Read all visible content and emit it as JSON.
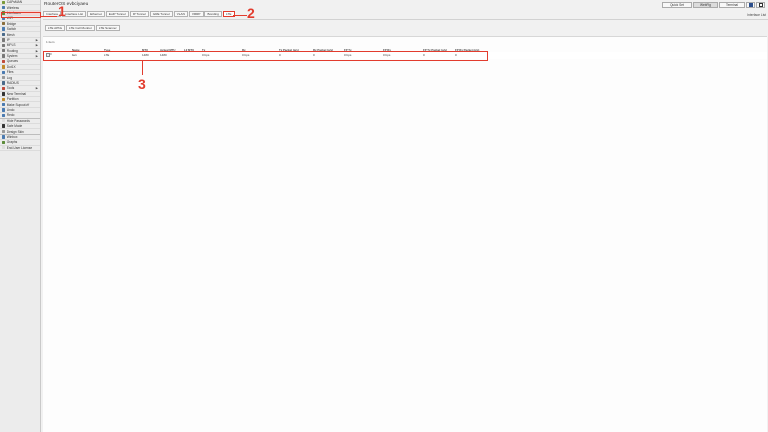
{
  "window": {
    "title": "RouterOS evbciyaeu",
    "view_label": "Interface List"
  },
  "top_buttons": {
    "quick_set": "Quick Set",
    "webfig": "WebFig",
    "terminal": "Terminal"
  },
  "icons": {
    "save": "save-icon",
    "window": "window-icon"
  },
  "sidebar": {
    "items": [
      {
        "label": "CAPsMAN",
        "icon": "capsman-icon",
        "color": "#7a9a3a"
      },
      {
        "label": "Wireless",
        "icon": "wireless-icon",
        "color": "#4a7ab0"
      },
      {
        "label": "Interfaces",
        "icon": "interfaces-icon",
        "color": "#5d8c3a",
        "active": true
      },
      {
        "label": "WiFi",
        "icon": "wifi-icon",
        "color": "#4a7ab0"
      },
      {
        "label": "Bridge",
        "icon": "bridge-icon",
        "color": "#8a6d3b"
      },
      {
        "label": "Switch",
        "icon": "switch-icon",
        "color": "#4a7ab0"
      },
      {
        "label": "Mesh",
        "icon": "mesh-icon",
        "color": "#4a6a8a"
      },
      {
        "label": "IP",
        "icon": "ip-icon",
        "color": "#777777",
        "arrow": true
      },
      {
        "label": "MPLS",
        "icon": "mpls-icon",
        "color": "#777777",
        "arrow": true
      },
      {
        "label": "Routing",
        "icon": "routing-icon",
        "color": "#777777",
        "arrow": true
      },
      {
        "label": "System",
        "icon": "system-icon",
        "color": "#777777",
        "arrow": true
      },
      {
        "label": "Queues",
        "icon": "queues-icon",
        "color": "#c04a3a"
      },
      {
        "label": "Dot1X",
        "icon": "dot1x-icon",
        "color": "#c08a2a"
      },
      {
        "label": "Files",
        "icon": "files-icon",
        "color": "#4a7ab0"
      },
      {
        "label": "Log",
        "icon": "log-icon",
        "color": "#999999"
      },
      {
        "label": "RADIUS",
        "icon": "radius-icon",
        "color": "#4a6a8a"
      },
      {
        "label": "Tools",
        "icon": "tools-icon",
        "color": "#c04a3a",
        "arrow": true
      },
      {
        "label": "New Terminal",
        "icon": "terminal-icon",
        "color": "#333333"
      },
      {
        "label": "Partition",
        "icon": "partition-icon",
        "color": "#c08a2a"
      },
      {
        "label": "Make Supout.rif",
        "icon": "supout-icon",
        "color": "#4a7ab0"
      },
      {
        "label": "Undo",
        "icon": "undo-icon",
        "color": "#4a7ab0"
      },
      {
        "label": "Redo",
        "icon": "redo-icon",
        "color": "#4a7ab0",
        "sep": true
      },
      {
        "label": "Hide Passwords",
        "icon": "hide-passwords-icon",
        "color": "#dddddd"
      },
      {
        "label": "Safe Mode",
        "icon": "safe-mode-icon",
        "color": "#333333"
      },
      {
        "label": "Design Skin",
        "icon": "design-skin-icon",
        "color": "#999999",
        "sep": true
      },
      {
        "label": "Winbox",
        "icon": "winbox-icon",
        "color": "#4a7ab0"
      },
      {
        "label": "Graphs",
        "icon": "graphs-icon",
        "color": "#5d8c3a"
      },
      {
        "label": "End-User License",
        "icon": "license-icon",
        "color": "#dddddd"
      }
    ]
  },
  "tabs": [
    "Interface",
    "Interface List",
    "Ethernet",
    "EoIP Tunnel",
    "IP Tunnel",
    "GRE Tunnel",
    "VLAN",
    "VRRP",
    "Bonding",
    "LTE"
  ],
  "active_tab": "LTE",
  "sub_buttons": [
    "LTE APNs",
    "LTE Cell Monitor",
    "LTE Scanner"
  ],
  "item_count": "1 item",
  "table": {
    "columns": [
      "Name",
      "Type",
      "MTU",
      "Actual MTU",
      "L2 MTU",
      "Tx",
      "Rx",
      "Tx Packet (p/s)",
      "Rx Packet (p/s)",
      "FP Tx",
      "FP Rx",
      "FP Tx Packet (p/s)",
      "FP Rx Packet (p/s)"
    ],
    "rows": [
      {
        "flag": "R",
        "cells": [
          "lte1",
          "LTE",
          "1480",
          "1480",
          "",
          "0 bps",
          "0 bps",
          "0",
          "0",
          "0 bps",
          "0 bps",
          "0",
          "0"
        ]
      }
    ]
  },
  "annotations": {
    "a1": "1",
    "a2": "2",
    "a3": "3",
    "color": "#e23c2e"
  }
}
